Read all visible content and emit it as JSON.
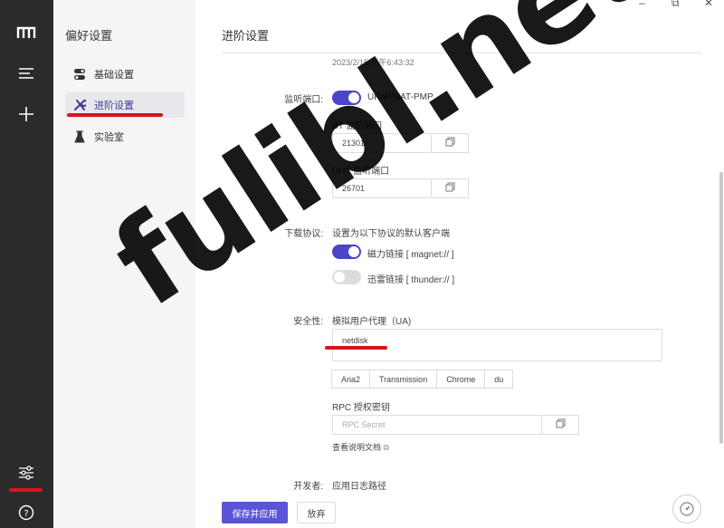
{
  "rail": {
    "logo": "m-logo",
    "menu_icon": "menu-icon",
    "add_icon": "plus-icon",
    "settings_icon": "sliders-icon",
    "help_icon": "help-icon"
  },
  "nav": {
    "title": "偏好设置",
    "items": [
      {
        "label": "基础设置",
        "icon": "toggle-icon"
      },
      {
        "label": "进阶设置",
        "icon": "tools-icon"
      },
      {
        "label": "实验室",
        "icon": "flask-icon"
      }
    ]
  },
  "window": {
    "minimize": "–",
    "restore": "⧉",
    "close": "✕"
  },
  "main": {
    "title": "进阶设置",
    "timestamp": "2023/2/15 下午6:43:32",
    "listen_port": {
      "label": "监听端口:",
      "upnp_label": "UPnP/NAT-PMP",
      "bt_label": "BT 监听端口",
      "bt_value": "21301",
      "dht_label": "DHT 监听端口",
      "dht_value": "26701"
    },
    "protocol": {
      "label": "下载协议:",
      "desc": "设置为以下协议的默认客户端",
      "magnet": "磁力链接 [ magnet:// ]",
      "thunder": "迅雷链接 [ thunder:// ]"
    },
    "security": {
      "label": "安全性:",
      "ua_label": "模拟用户代理（UA)",
      "ua_value": "netdisk",
      "ua_presets": [
        "Aria2",
        "Transmission",
        "Chrome",
        "du"
      ],
      "rpc_label": "RPC 授权密钥",
      "rpc_placeholder": "RPC Secret",
      "doc_link": "查看说明文档"
    },
    "developer": {
      "label": "开发者:",
      "log_label": "应用日志路径"
    },
    "save_button": "保存并应用",
    "discard_button": "放弃"
  },
  "watermark": "fulibl.net",
  "colors": {
    "accent": "#5a55d6",
    "rail": "#2b2b2b",
    "annotation": "#d8141b"
  }
}
